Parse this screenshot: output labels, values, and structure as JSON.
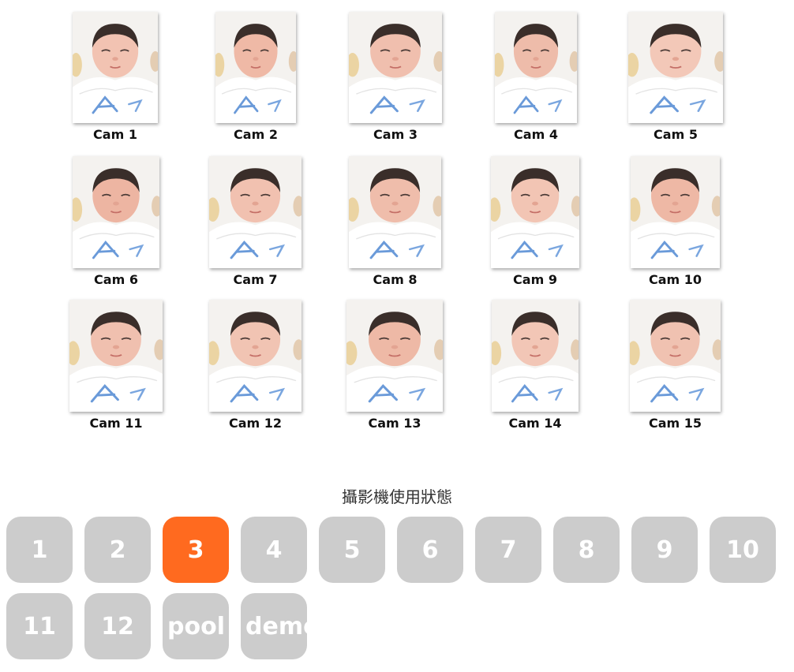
{
  "cameras": [
    {
      "label": "Cam 1"
    },
    {
      "label": "Cam 2"
    },
    {
      "label": "Cam 3"
    },
    {
      "label": "Cam 4"
    },
    {
      "label": "Cam 5"
    },
    {
      "label": "Cam 6"
    },
    {
      "label": "Cam 7"
    },
    {
      "label": "Cam 8"
    },
    {
      "label": "Cam 9"
    },
    {
      "label": "Cam 10"
    },
    {
      "label": "Cam 11"
    },
    {
      "label": "Cam 12"
    },
    {
      "label": "Cam 13"
    },
    {
      "label": "Cam 14"
    },
    {
      "label": "Cam 15"
    }
  ],
  "status": {
    "title": "攝影機使用狀態"
  },
  "buttons": [
    {
      "label": "1"
    },
    {
      "label": "2"
    },
    {
      "label": "3",
      "active": true
    },
    {
      "label": "4"
    },
    {
      "label": "5"
    },
    {
      "label": "6"
    },
    {
      "label": "7"
    },
    {
      "label": "8"
    },
    {
      "label": "9"
    },
    {
      "label": "10"
    },
    {
      "label": "11"
    },
    {
      "label": "12"
    },
    {
      "label": "pool"
    },
    {
      "label": "demo"
    }
  ],
  "colors": {
    "button_default": "#cccccc",
    "button_active": "#ff6a1f",
    "button_text": "#ffffff"
  }
}
